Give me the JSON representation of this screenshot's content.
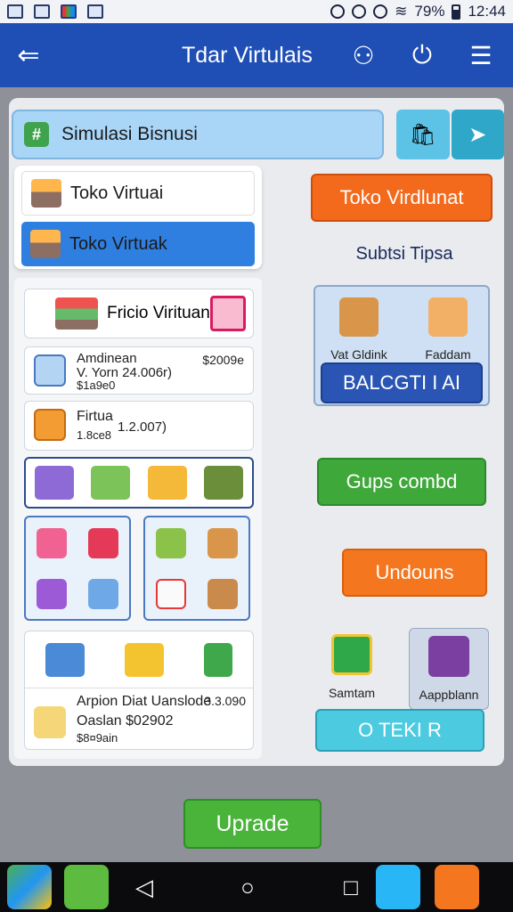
{
  "status_bar": {
    "battery_text": "79%",
    "time": "12:44"
  },
  "app_bar": {
    "title": "Tdar Virtulais",
    "back_icon": "arrow-left-icon"
  },
  "search": {
    "label": "Simulasi Bisnusi"
  },
  "dropdown": {
    "items": [
      {
        "label": "Toko Virtuai"
      },
      {
        "label": "Toko Virtuak"
      }
    ]
  },
  "left_cards": {
    "product_card": {
      "label": "Fricio Virituan"
    },
    "card2": {
      "title": "Amdinean",
      "line2": "V. Yorn 24.006r)",
      "line3": "$1a9e0",
      "value": "$2009e"
    },
    "card3": {
      "title": "Firtua",
      "line2": "1.8ce8",
      "value": "1.2.007)"
    },
    "bottom_card": {
      "title": "Arpion Diat Uanslode",
      "value": "3.3.090",
      "line2": "Oaslan $02902",
      "line3": "$8¤9ain"
    }
  },
  "right_col": {
    "toko_button": "Toko Virdlunat",
    "subtitle": "Subtsi Tipsa",
    "feat1": "Vat Gldink",
    "feat2": "Faddam",
    "balance_button": "BALCGTI I AI",
    "green_button": "Gups combd",
    "orange_button": "Undouns",
    "item1": "Samtam",
    "item2": "Aappblann",
    "teal_button": "O  TEKI  R"
  },
  "upgrade_button": "Uprade",
  "colors": {
    "primary": "#1f4fb5",
    "orange": "#f36a1d",
    "green": "#3fa83b",
    "teal": "#4ccbe0",
    "balance": "#2a55b4"
  }
}
